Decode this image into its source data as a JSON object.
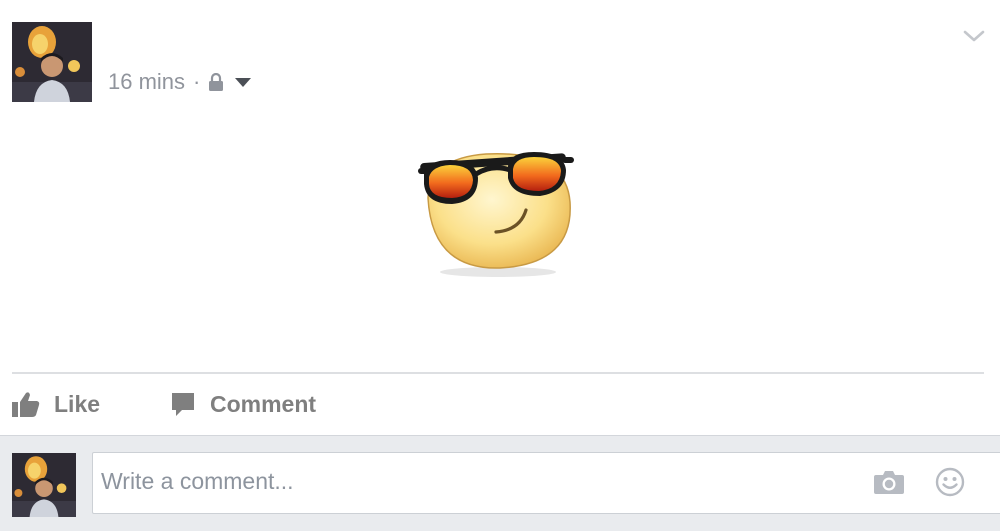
{
  "post": {
    "timestamp": "16 mins",
    "separator": "·",
    "privacy_icon": "lock-icon",
    "audience_icon": "caret-down-icon",
    "options_icon": "chevron-down-icon",
    "sticker": "cool-sunglasses-emoji-sticker"
  },
  "actions": {
    "like_label": "Like",
    "like_icon": "thumbs-up-icon",
    "comment_label": "Comment",
    "comment_icon": "speech-bubble-icon"
  },
  "composer": {
    "placeholder": "Write a comment...",
    "camera_icon": "camera-icon",
    "emoji_icon": "smiley-icon"
  },
  "colors": {
    "meta_text": "#90949c",
    "action_text": "#7f7f7f",
    "composer_bg": "#e9ebee",
    "divider": "#dddfe2"
  }
}
